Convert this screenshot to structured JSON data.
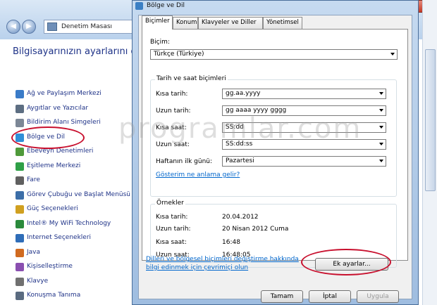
{
  "control_panel": {
    "breadcrumb": "Denetim Masası",
    "heading": "Bilgisayarınızın ayarlarını düz",
    "items": [
      {
        "label": "Ağ ve Paylaşım Merkezi",
        "icon": "network-icon",
        "color": "#3a7bc8"
      },
      {
        "label": "Aygıtlar ve Yazıcılar",
        "icon": "printer-icon",
        "color": "#5d6e82"
      },
      {
        "label": "Bildirim Alanı Simgeleri",
        "icon": "notification-icon",
        "color": "#7c8796"
      },
      {
        "label": "Bölge ve Dil",
        "icon": "globe-icon",
        "color": "#2f8fd8"
      },
      {
        "label": "Ebeveyn Denetimleri",
        "icon": "parental-icon",
        "color": "#4f9a3a"
      },
      {
        "label": "Eşitleme Merkezi",
        "icon": "sync-icon",
        "color": "#2fa047"
      },
      {
        "label": "Fare",
        "icon": "mouse-icon",
        "color": "#606060"
      },
      {
        "label": "Görev Çubuğu ve Başlat Menüsü",
        "icon": "taskbar-icon",
        "color": "#3c6ea8"
      },
      {
        "label": "Güç Seçenekleri",
        "icon": "power-icon",
        "color": "#d0a020"
      },
      {
        "label": "Intel® My WiFi Technology",
        "icon": "wifi-icon",
        "color": "#2a8a3c"
      },
      {
        "label": "Internet Seçenekleri",
        "icon": "internet-icon",
        "color": "#2f6db8"
      },
      {
        "label": "Java",
        "icon": "java-icon",
        "color": "#d06a20"
      },
      {
        "label": "Kişiselleştirme",
        "icon": "personalize-icon",
        "color": "#8a4fb0"
      },
      {
        "label": "Klavye",
        "icon": "keyboard-icon",
        "color": "#707070"
      },
      {
        "label": "Konuşma Tanıma",
        "icon": "microphone-icon",
        "color": "#5a6b80"
      }
    ]
  },
  "watermark": "programlar.com",
  "dialog": {
    "title": "Bölge ve Dil",
    "tabs": [
      "Biçimler",
      "Konum",
      "Klavyeler ve Diller",
      "Yönetimsel"
    ],
    "format_label": "Biçim:",
    "format_value": "Türkçe (Türkiye)",
    "datetime_group": "Tarih ve saat biçimleri",
    "short_date_label": "Kısa tarih:",
    "short_date_value": "gg.aa.yyyy",
    "long_date_label": "Uzun tarih:",
    "long_date_value": "gg aaaa yyyy gggg",
    "short_time_label": "Kısa saat:",
    "short_time_value": "SS:dd",
    "long_time_label": "Uzun saat:",
    "long_time_value": "SS:dd:ss",
    "first_day_label": "Haftanın ilk günü:",
    "first_day_value": "Pazartesi",
    "notation_link": "Gösterim ne anlama gelir?",
    "examples_group": "Örnekler",
    "ex_short_date_label": "Kısa tarih:",
    "ex_short_date_value": "20.04.2012",
    "ex_long_date_label": "Uzun tarih:",
    "ex_long_date_value": "20 Nisan 2012 Cuma",
    "ex_short_time_label": "Kısa saat:",
    "ex_short_time_value": "16:48",
    "ex_long_time_label": "Uzun saat:",
    "ex_long_time_value": "16:48:05",
    "info_link_line1": "Dilleri ve bölgesel biçimleri değiştirme hakkında",
    "info_link_line2": "bilgi edinmek için çevrimiçi olun",
    "additional_settings_button": "Ek ayarlar...",
    "ok_button": "Tamam",
    "cancel_button": "İptal",
    "apply_button": "Uygula"
  }
}
